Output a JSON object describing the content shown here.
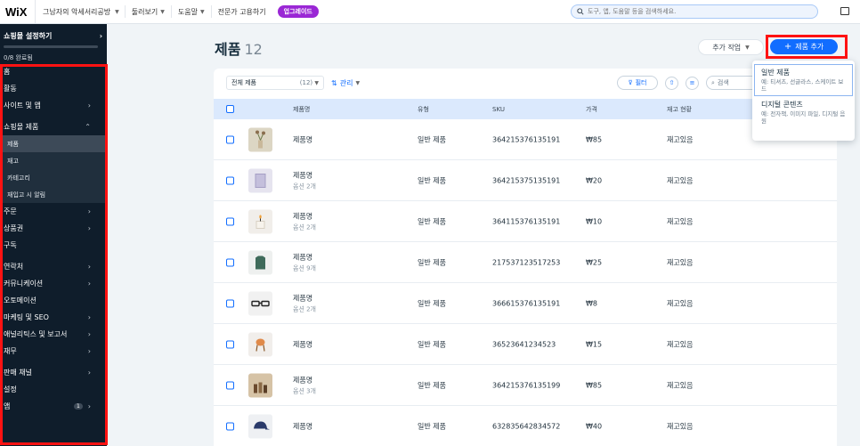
{
  "topbar": {
    "logo": "WiX",
    "site_name": "그남자의 악세서리공방",
    "menu": [
      "둘러보기",
      "도움말",
      "전문가 고용하기"
    ],
    "upgrade": "업그레이드",
    "search_placeholder": "도구, 앱, 도움말 등을 검색하세요."
  },
  "sidebar": {
    "setup_title": "쇼핑몰 설정하기",
    "setup_progress": 0,
    "setup_status": "0/8 완료됨",
    "items": [
      {
        "label": "홈",
        "arrow": ""
      },
      {
        "label": "활동",
        "arrow": ""
      },
      {
        "label": "사이트 및 앱",
        "arrow": "›"
      },
      {
        "label": "쇼핑몰 제품",
        "arrow": "⌃"
      }
    ],
    "sub_items": [
      "제품",
      "재고",
      "카테고리",
      "재입고 시 알림"
    ],
    "items2": [
      {
        "label": "주문",
        "arrow": "›"
      },
      {
        "label": "상품권",
        "arrow": "›"
      },
      {
        "label": "구독",
        "arrow": ""
      }
    ],
    "items3": [
      {
        "label": "연락처",
        "arrow": "›"
      },
      {
        "label": "커뮤니케이션",
        "arrow": "›"
      },
      {
        "label": "오토메이션",
        "arrow": ""
      },
      {
        "label": "마케팅 및 SEO",
        "arrow": "›"
      },
      {
        "label": "애널리틱스 및 보고서",
        "arrow": "›"
      },
      {
        "label": "재무",
        "arrow": "›"
      }
    ],
    "items4": [
      {
        "label": "판매 채널",
        "arrow": "›"
      },
      {
        "label": "설정",
        "arrow": ""
      },
      {
        "label": "앱",
        "arrow": "›",
        "badge": "1"
      }
    ]
  },
  "main": {
    "title": "제품",
    "count": "12",
    "more_actions": "추가 작업",
    "add_button": "제품 추가",
    "filter_select": "전체 제품",
    "filter_count": "(12)",
    "manage": "관리",
    "filter_btn": "필터",
    "search": "검색"
  },
  "table": {
    "headers": {
      "name": "제품명",
      "type": "유형",
      "sku": "SKU",
      "price": "가격",
      "stock": "재고 현황"
    },
    "rows": [
      {
        "name": "제품명",
        "sub": "",
        "type": "일반 제품",
        "sku": "364215376135191",
        "price": "₩85",
        "stock": "재고있음",
        "thumb": "flower-vase-icon"
      },
      {
        "name": "제품명",
        "sub": "옵션 2개",
        "type": "일반 제품",
        "sku": "364215375135191",
        "price": "₩20",
        "stock": "재고있음",
        "thumb": "notebook-icon"
      },
      {
        "name": "제품명",
        "sub": "옵션 2개",
        "type": "일반 제품",
        "sku": "364115376135191",
        "price": "₩10",
        "stock": "재고있음",
        "thumb": "candle-icon"
      },
      {
        "name": "제품명",
        "sub": "옵션 9개",
        "type": "일반 제품",
        "sku": "217537123517253",
        "price": "₩25",
        "stock": "재고있음",
        "thumb": "shirt-icon"
      },
      {
        "name": "제품명",
        "sub": "옵션 2개",
        "type": "일반 제품",
        "sku": "366615376135191",
        "price": "₩8",
        "stock": "재고있음",
        "thumb": "glasses-icon"
      },
      {
        "name": "제품명",
        "sub": "",
        "type": "일반 제품",
        "sku": "36523641234523",
        "price": "₩15",
        "stock": "재고있음",
        "thumb": "chair-icon"
      },
      {
        "name": "제품명",
        "sub": "옵션 3개",
        "type": "일반 제품",
        "sku": "364215376135199",
        "price": "₩85",
        "stock": "재고있음",
        "thumb": "bottles-icon"
      },
      {
        "name": "제품명",
        "sub": "",
        "type": "일반 제품",
        "sku": "632835642834572",
        "price": "₩40",
        "stock": "재고있음",
        "thumb": "cap-icon"
      }
    ]
  },
  "dropdown": {
    "items": [
      {
        "title": "일반 제품",
        "desc": "예: 티셔츠, 선글라스, 스케이트 보드"
      },
      {
        "title": "디지털 콘텐츠",
        "desc": "예: 전자책, 이미지 파일, 디지털 음원"
      }
    ]
  }
}
